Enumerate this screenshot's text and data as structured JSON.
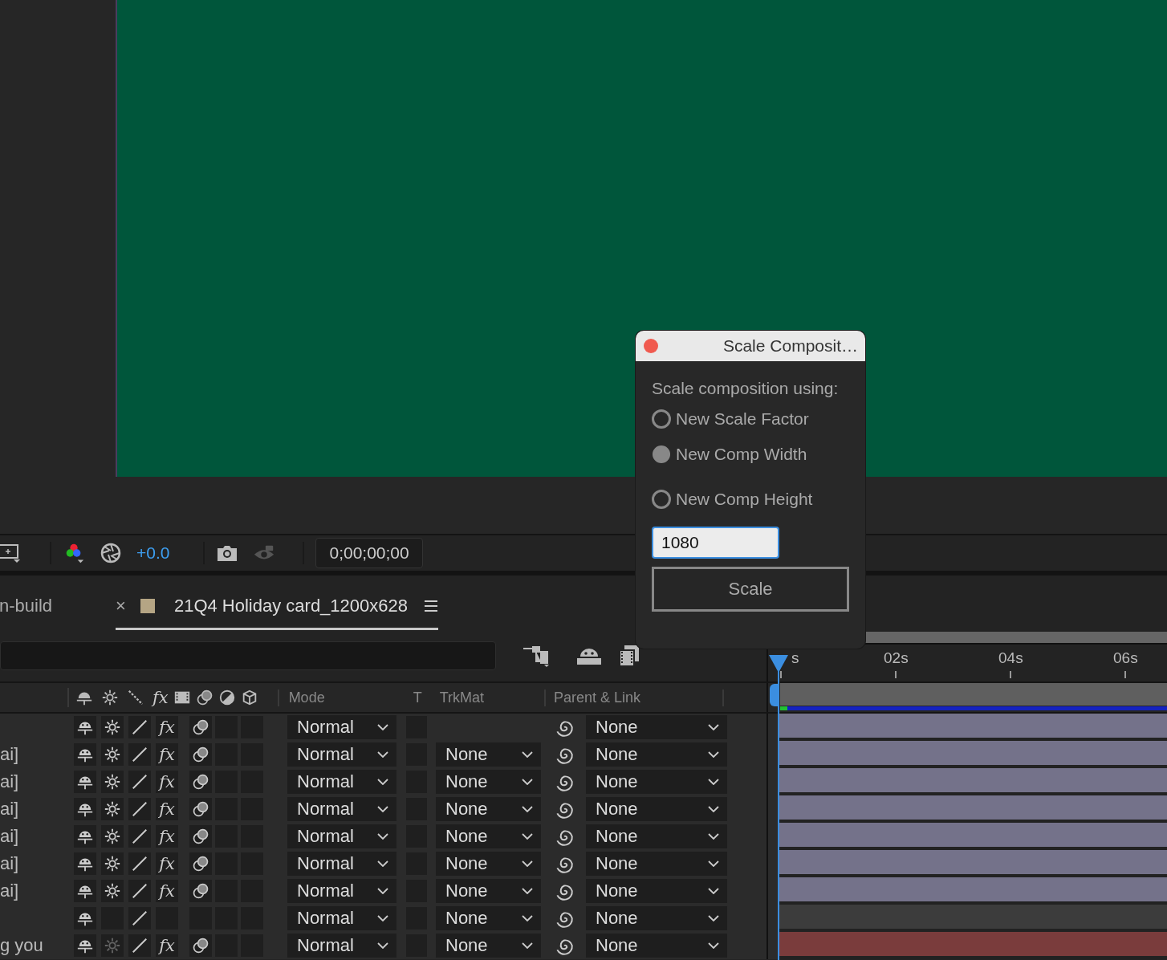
{
  "viewer_toolbar": {
    "exposure": "+0.0",
    "timecode": "0;00;00;00"
  },
  "tabs": [
    {
      "label": "n-build",
      "selected": false
    },
    {
      "label": "21Q4 Holiday card_1200x628",
      "selected": true,
      "close": "×",
      "color": "#b5a584"
    }
  ],
  "ruler": {
    "labels": [
      "s",
      "02s",
      "04s",
      "06s"
    ]
  },
  "columns": {
    "effects": "fx",
    "mode": "Mode",
    "t": "T",
    "trkmat": "TrkMat",
    "parent": "Parent & Link"
  },
  "layers": [
    {
      "kind": "layer",
      "collapse": true,
      "effects": "fx",
      "effects_on": true,
      "mode": "Normal",
      "parent": "None",
      "color": "#74728a"
    },
    {
      "name": "ai]",
      "kind": "layer",
      "collapse": true,
      "effects": "fx",
      "effects_on": true,
      "mode": "Normal",
      "trkmat": "None",
      "parent": "None",
      "color": "#74728a"
    },
    {
      "name": "ai]",
      "kind": "layer",
      "collapse": true,
      "effects": "fx",
      "effects_on": true,
      "mode": "Normal",
      "trkmat": "None",
      "parent": "None",
      "color": "#74728a"
    },
    {
      "name": "ai]",
      "kind": "layer",
      "collapse": true,
      "effects": "fx",
      "effects_on": true,
      "mode": "Normal",
      "trkmat": "None",
      "parent": "None",
      "color": "#74728a"
    },
    {
      "name": "ai]",
      "kind": "layer",
      "collapse": true,
      "effects": "fx",
      "effects_on": true,
      "mode": "Normal",
      "trkmat": "None",
      "parent": "None",
      "color": "#74728a"
    },
    {
      "name": "ai]",
      "kind": "layer",
      "collapse": true,
      "effects": "fx",
      "effects_on": true,
      "mode": "Normal",
      "trkmat": "None",
      "parent": "None",
      "color": "#74728a"
    },
    {
      "name": "ai]",
      "kind": "layer",
      "collapse": true,
      "effects": "fx",
      "effects_on": true,
      "mode": "Normal",
      "trkmat": "None",
      "parent": "None",
      "color": "#74728a"
    },
    {
      "kind": "plain",
      "mode": "Normal",
      "trkmat": "None",
      "parent": "None",
      "color": "#3c3c3c"
    },
    {
      "name": "g you",
      "kind": "layer",
      "collapse": false,
      "effects": "fx",
      "effects_on": true,
      "mode": "Normal",
      "trkmat": "None",
      "parent": "None",
      "color": "#7a3c3c"
    }
  ],
  "dialog": {
    "title": "Scale Composit…",
    "prompt": "Scale composition using:",
    "options": [
      {
        "label": "New Scale Factor",
        "selected": false
      },
      {
        "label": "New Comp Width",
        "selected": true
      },
      {
        "label": "New Comp Height",
        "selected": false
      }
    ],
    "value": "1080",
    "button": "Scale"
  }
}
